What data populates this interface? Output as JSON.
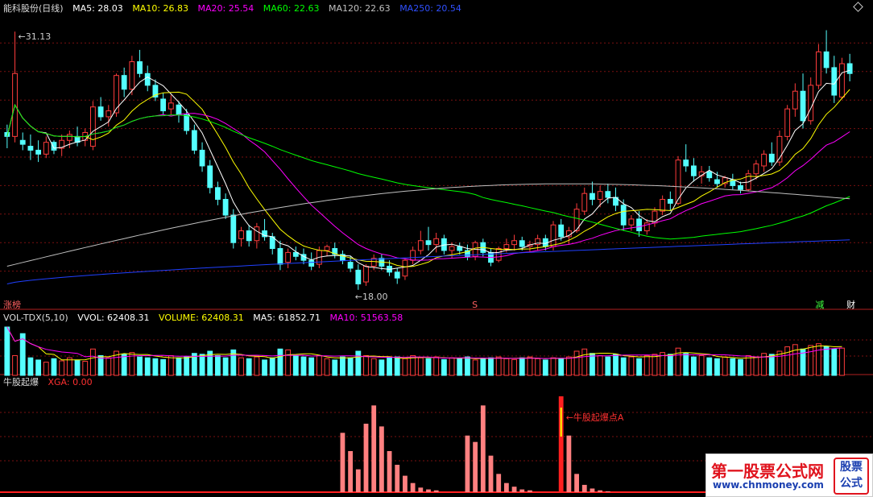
{
  "header": {
    "stock": "能科股份(日线)",
    "ma5": "MA5: 28.03",
    "ma10": "MA10: 26.83",
    "ma20": "MA20: 25.54",
    "ma60": "MA60: 22.63",
    "ma120": "MA120: 22.63",
    "ma250": "MA250: 20.54"
  },
  "vol_header": {
    "name": "VOL-TDX(5,10)",
    "vvol": "VVOL: 62408.31",
    "volume": "VOLUME: 62408.31",
    "ma5": "MA5: 61852.71",
    "ma10": "MA10: 51563.58"
  },
  "ind_header": {
    "name": "牛股起爆",
    "xga": "XGA: 0.00"
  },
  "price_labels": {
    "high": "31.13",
    "low": "18.00",
    "annotation": "牛股起爆点A"
  },
  "markers": [
    "涨榜",
    "S",
    "减",
    "财"
  ],
  "logo": {
    "title": "第一股票公式网",
    "url": "www.chnmoney.com",
    "box": "股票公式"
  },
  "colors": {
    "up": "#ff3c3c",
    "down": "#54ffff",
    "ma5": "#ffffff",
    "ma10": "#ffff00",
    "ma20": "#ff00ff",
    "ma60": "#00ff00",
    "ma120": "#c0c0c0",
    "ma250": "#2040ff",
    "signal": "#ff8080"
  },
  "chart_data": {
    "type": "candlestick",
    "ylim": [
      17.5,
      32
    ],
    "high_label": 31.13,
    "low_label": 18.0,
    "candles": [
      [
        26.0,
        26.4,
        25.2,
        25.8
      ],
      [
        25.8,
        31.13,
        25.5,
        29.0
      ],
      [
        25.6,
        26.0,
        25.1,
        25.4
      ],
      [
        25.3,
        25.9,
        24.6,
        25.1
      ],
      [
        25.1,
        25.6,
        24.5,
        24.9
      ],
      [
        24.9,
        25.8,
        24.7,
        25.5
      ],
      [
        25.5,
        25.6,
        24.9,
        25.1
      ],
      [
        25.2,
        25.9,
        24.8,
        25.6
      ],
      [
        25.6,
        26.1,
        25.2,
        25.9
      ],
      [
        25.8,
        26.3,
        25.3,
        25.5
      ],
      [
        25.6,
        26.2,
        25.3,
        26.0
      ],
      [
        25.3,
        27.6,
        25.1,
        27.3
      ],
      [
        27.3,
        27.8,
        26.6,
        26.8
      ],
      [
        26.8,
        27.4,
        26.3,
        27.1
      ],
      [
        27.0,
        29.0,
        26.8,
        28.9
      ],
      [
        28.9,
        29.3,
        27.8,
        28.2
      ],
      [
        28.2,
        29.9,
        27.9,
        29.6
      ],
      [
        29.6,
        30.2,
        28.8,
        29.0
      ],
      [
        29.0,
        29.4,
        28.1,
        28.4
      ],
      [
        28.4,
        28.7,
        27.6,
        27.8
      ],
      [
        27.7,
        28.0,
        26.9,
        27.1
      ],
      [
        27.2,
        27.9,
        26.9,
        27.5
      ],
      [
        27.4,
        27.6,
        26.5,
        26.9
      ],
      [
        26.9,
        27.2,
        25.9,
        26.1
      ],
      [
        26.1,
        26.4,
        24.9,
        25.1
      ],
      [
        25.1,
        25.5,
        24.0,
        24.3
      ],
      [
        24.3,
        24.6,
        22.9,
        23.2
      ],
      [
        23.2,
        23.5,
        22.3,
        22.6
      ],
      [
        22.6,
        22.9,
        21.6,
        21.8
      ],
      [
        21.8,
        22.1,
        20.1,
        20.4
      ],
      [
        20.6,
        21.2,
        20.2,
        21.0
      ],
      [
        21.0,
        21.3,
        20.2,
        20.5
      ],
      [
        20.5,
        21.4,
        20.1,
        21.2
      ],
      [
        21.0,
        21.6,
        20.5,
        20.7
      ],
      [
        20.7,
        20.9,
        19.8,
        20.1
      ],
      [
        20.1,
        20.5,
        19.0,
        19.3
      ],
      [
        19.4,
        20.1,
        19.1,
        19.9
      ],
      [
        19.9,
        20.2,
        19.5,
        19.7
      ],
      [
        19.8,
        20.1,
        19.3,
        19.5
      ],
      [
        19.5,
        19.9,
        19.0,
        19.2
      ],
      [
        19.3,
        20.2,
        19.1,
        20.0
      ],
      [
        20.0,
        20.3,
        19.7,
        20.2
      ],
      [
        20.1,
        20.4,
        19.6,
        19.8
      ],
      [
        19.8,
        20.0,
        19.3,
        19.5
      ],
      [
        19.4,
        19.7,
        18.9,
        19.1
      ],
      [
        19.0,
        19.3,
        18.0,
        18.3
      ],
      [
        18.4,
        19.3,
        18.2,
        19.2
      ],
      [
        19.2,
        19.8,
        19.0,
        19.6
      ],
      [
        19.6,
        19.8,
        19.0,
        19.2
      ],
      [
        19.2,
        19.5,
        18.7,
        18.9
      ],
      [
        18.9,
        19.1,
        18.3,
        18.6
      ],
      [
        18.7,
        19.6,
        18.5,
        19.5
      ],
      [
        19.5,
        20.2,
        19.3,
        20.0
      ],
      [
        20.0,
        21.0,
        19.8,
        20.5
      ],
      [
        20.5,
        21.2,
        20.0,
        20.3
      ],
      [
        20.3,
        20.9,
        19.9,
        20.6
      ],
      [
        20.6,
        20.8,
        19.8,
        20.0
      ],
      [
        20.0,
        20.4,
        19.6,
        20.2
      ],
      [
        20.2,
        20.4,
        19.8,
        20.0
      ],
      [
        20.0,
        20.3,
        19.5,
        19.7
      ],
      [
        19.7,
        20.5,
        19.5,
        20.4
      ],
      [
        20.4,
        20.6,
        19.7,
        19.9
      ],
      [
        19.9,
        20.1,
        19.2,
        19.4
      ],
      [
        19.5,
        20.2,
        19.4,
        20.1
      ],
      [
        20.1,
        20.6,
        19.9,
        20.3
      ],
      [
        20.3,
        20.8,
        20.0,
        20.5
      ],
      [
        20.5,
        20.7,
        20.0,
        20.2
      ],
      [
        20.2,
        20.5,
        19.9,
        20.3
      ],
      [
        20.3,
        20.8,
        20.0,
        20.6
      ],
      [
        20.6,
        20.8,
        20.0,
        20.2
      ],
      [
        20.2,
        21.5,
        20.0,
        21.3
      ],
      [
        21.3,
        21.6,
        20.5,
        20.7
      ],
      [
        20.7,
        21.2,
        20.3,
        21.0
      ],
      [
        21.0,
        22.4,
        20.9,
        22.1
      ],
      [
        22.0,
        23.2,
        21.8,
        22.9
      ],
      [
        22.9,
        23.5,
        22.3,
        22.6
      ],
      [
        22.6,
        23.3,
        22.2,
        23.0
      ],
      [
        23.0,
        23.4,
        22.4,
        22.7
      ],
      [
        22.7,
        23.2,
        22.0,
        22.3
      ],
      [
        22.3,
        22.6,
        21.0,
        21.3
      ],
      [
        21.3,
        21.8,
        21.0,
        21.6
      ],
      [
        21.6,
        22.0,
        20.7,
        21.0
      ],
      [
        21.0,
        21.6,
        20.8,
        21.4
      ],
      [
        21.4,
        22.2,
        21.2,
        22.0
      ],
      [
        22.0,
        22.8,
        21.8,
        22.6
      ],
      [
        22.6,
        23.0,
        22.0,
        22.4
      ],
      [
        22.4,
        24.8,
        22.3,
        24.6
      ],
      [
        24.6,
        25.4,
        24.0,
        24.3
      ],
      [
        24.3,
        24.7,
        23.5,
        23.8
      ],
      [
        23.8,
        24.3,
        23.4,
        24.0
      ],
      [
        24.0,
        24.3,
        23.5,
        23.7
      ],
      [
        23.6,
        24.0,
        23.2,
        23.4
      ],
      [
        23.4,
        23.8,
        23.2,
        23.7
      ],
      [
        23.6,
        23.9,
        23.1,
        23.3
      ],
      [
        23.3,
        23.5,
        22.9,
        23.1
      ],
      [
        23.1,
        24.1,
        23.0,
        23.9
      ],
      [
        23.9,
        24.6,
        23.6,
        24.4
      ],
      [
        24.3,
        25.1,
        24.0,
        24.9
      ],
      [
        24.9,
        25.5,
        24.3,
        24.5
      ],
      [
        24.5,
        26.1,
        24.3,
        25.8
      ],
      [
        25.8,
        27.4,
        25.6,
        27.2
      ],
      [
        27.2,
        28.5,
        26.8,
        28.1
      ],
      [
        28.1,
        29.0,
        26.2,
        26.6
      ],
      [
        26.6,
        28.8,
        26.4,
        28.4
      ],
      [
        28.4,
        30.5,
        28.2,
        30.1
      ],
      [
        30.1,
        31.2,
        29.0,
        29.3
      ],
      [
        29.3,
        29.9,
        27.5,
        27.9
      ],
      [
        27.8,
        29.8,
        27.7,
        29.5
      ],
      [
        29.5,
        30.0,
        28.6,
        29.0
      ]
    ],
    "ma_values": {
      "ma250_end": 20.54,
      "ma120_end": 22.63,
      "ma60_end": 22.63,
      "ma20_end": 25.54,
      "ma10_end": 26.83,
      "ma5_end": 28.03
    },
    "volume": [
      110,
      45,
      95,
      40,
      35,
      30,
      38,
      33,
      40,
      35,
      32,
      60,
      45,
      40,
      55,
      48,
      52,
      42,
      40,
      38,
      36,
      45,
      40,
      42,
      50,
      48,
      55,
      45,
      40,
      58,
      40,
      38,
      42,
      35,
      40,
      60,
      58,
      45,
      42,
      40,
      45,
      38,
      35,
      42,
      40,
      55,
      45,
      38,
      35,
      40,
      42,
      38,
      45,
      40,
      38,
      42,
      36,
      40,
      38,
      42,
      35,
      38,
      40,
      42,
      38,
      36,
      40,
      42,
      38,
      35,
      40,
      38,
      42,
      55,
      60,
      50,
      45,
      42,
      48,
      40,
      42,
      38,
      45,
      48,
      52,
      48,
      62,
      50,
      42,
      45,
      40,
      38,
      42,
      38,
      36,
      45,
      42,
      50,
      48,
      55,
      65,
      70,
      60,
      68,
      72,
      65,
      60,
      62
    ],
    "signal": [
      0,
      0,
      0,
      0,
      0,
      0,
      0,
      0,
      0,
      0,
      0,
      0,
      0,
      0,
      0,
      0,
      0,
      0,
      0,
      0,
      0,
      0,
      0,
      0,
      0,
      0,
      0,
      0,
      0,
      0,
      0,
      0,
      0,
      0,
      0,
      0,
      0,
      0,
      0,
      0,
      0,
      0,
      0,
      0.65,
      0.45,
      0.25,
      0.75,
      0.95,
      0.72,
      0.45,
      0.3,
      0.18,
      0.1,
      0.05,
      0.03,
      0.02,
      0,
      0,
      0,
      0.62,
      0.55,
      0.95,
      0.4,
      0.2,
      0.1,
      0.06,
      0.03,
      0.02,
      0,
      0,
      0,
      1.05,
      0.62,
      0.2,
      0.08,
      0.04,
      0.02,
      0.01,
      0,
      0,
      0,
      0,
      0,
      0,
      0,
      0,
      0,
      0,
      0,
      0,
      0,
      0,
      0,
      0,
      0,
      0,
      0,
      0,
      0,
      0,
      0,
      0,
      0,
      0,
      0,
      0,
      0,
      0,
      0
    ],
    "marker_positions": [
      "涨榜@0",
      "S@60",
      "减@104",
      "财@119"
    ]
  }
}
